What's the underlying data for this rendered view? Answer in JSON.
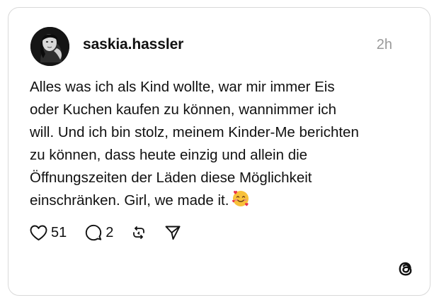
{
  "post": {
    "username": "saskia.hassler",
    "timestamp": "2h",
    "text_lines": [
      "Alles was ich als Kind wollte, war mir immer Eis",
      "oder Kuchen kaufen zu können, wannimmer ich",
      "will. Und ich bin stolz, meinem Kinder-Me berichten",
      "zu können, dass heute einzig und allein die",
      "Öffnungszeiten der Läden diese Möglichkeit",
      "einschränken. Girl, we made it."
    ],
    "emoji": "smiling-face-with-hearts-icon"
  },
  "actions": {
    "like_count": "51",
    "reply_count": "2"
  },
  "icons": {
    "like": "heart-icon",
    "reply": "speech-bubble-icon",
    "repost": "repost-icon",
    "share": "paper-plane-icon",
    "brand": "threads-logo-icon"
  },
  "colors": {
    "text": "#111111",
    "muted": "#9a9a9a",
    "border": "#d9d9d9"
  }
}
